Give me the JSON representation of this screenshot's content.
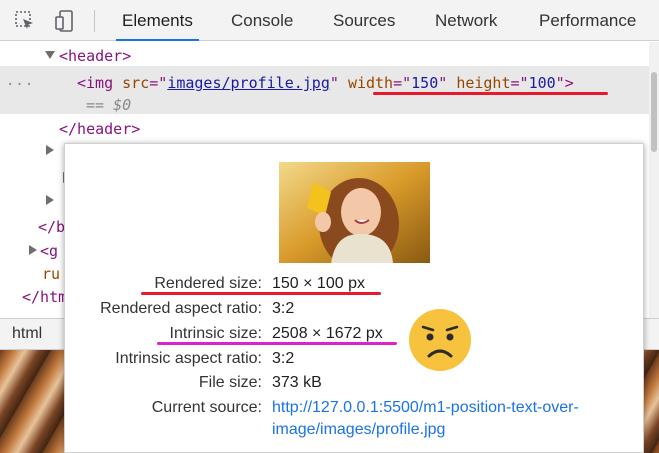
{
  "toolbar": {
    "tabs": [
      "Elements",
      "Console",
      "Sources",
      "Network",
      "Performance"
    ],
    "active_tab": "Elements"
  },
  "tree": {
    "header_open": "<header>",
    "img_open": "<img",
    "src_attr": "src",
    "src_value": "images/profile.jpg",
    "width_attr": "width",
    "width_value": "150",
    "height_attr": "height",
    "height_value": "100",
    "img_close": ">",
    "selected_marker": "== $0",
    "header_close": "</header>",
    "row_partial_1": "</b",
    "row_partial_2": "<g",
    "row_partial_3": "ru",
    "row_partial_4": "</htm",
    "ellipsis": "..."
  },
  "breadcrumb": {
    "item": "html"
  },
  "tooltip": {
    "rendered_size_label": "Rendered size:",
    "rendered_size_value": "150 × 100 px",
    "rendered_ratio_label": "Rendered aspect ratio:",
    "rendered_ratio_value": "3:2",
    "intrinsic_size_label": "Intrinsic size:",
    "intrinsic_size_value": "2508 × 1672 px",
    "intrinsic_ratio_label": "Intrinsic aspect ratio:",
    "intrinsic_ratio_value": "3:2",
    "file_size_label": "File size:",
    "file_size_value": "373 kB",
    "current_source_label": "Current source:",
    "current_source_value": "http://127.0.0.1:5500/m1-position-text-over-image/images/profile.jpg"
  },
  "colors": {
    "active_tab_underline": "#1a73e8",
    "annotation_red": "#e8192c",
    "annotation_pink": "#e020c8",
    "emoji_face": "#f7c23e"
  },
  "icons": [
    "inspect-element-icon",
    "device-toggle-icon",
    "sad-face-emoji"
  ]
}
